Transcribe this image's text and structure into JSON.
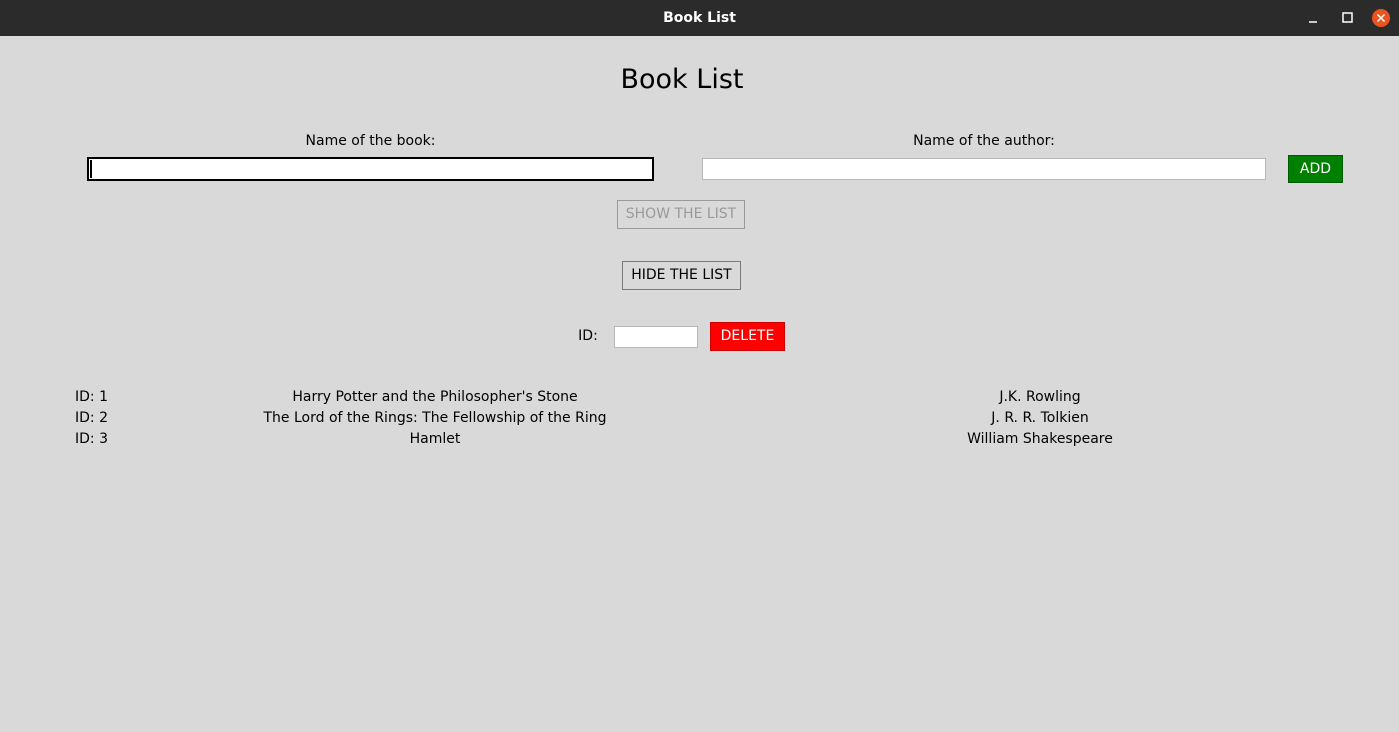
{
  "window": {
    "title": "Book List"
  },
  "heading": "Book List",
  "form": {
    "book_label": "Name of the book:",
    "book_value": "",
    "author_label": "Name of the author:",
    "author_value": "",
    "add_label": "ADD",
    "add_color": "#007f00"
  },
  "show_label": "SHOW THE LIST",
  "hide_label": "HIDE THE LIST",
  "delete_form": {
    "id_label": "ID:",
    "id_value": "",
    "delete_label": "DELETE",
    "delete_color": "#ff0000"
  },
  "books": [
    {
      "id": "ID: 1",
      "title": "Harry Potter and the Philosopher's Stone",
      "author": "J.K. Rowling"
    },
    {
      "id": "ID: 2",
      "title": "The Lord of the Rings: The Fellowship of the Ring",
      "author": "J. R. R. Tolkien"
    },
    {
      "id": "ID: 3",
      "title": "Hamlet",
      "author": "William Shakespeare"
    }
  ],
  "icons": {
    "minimize": "minimize-icon",
    "maximize": "maximize-icon",
    "close": "close-icon"
  }
}
